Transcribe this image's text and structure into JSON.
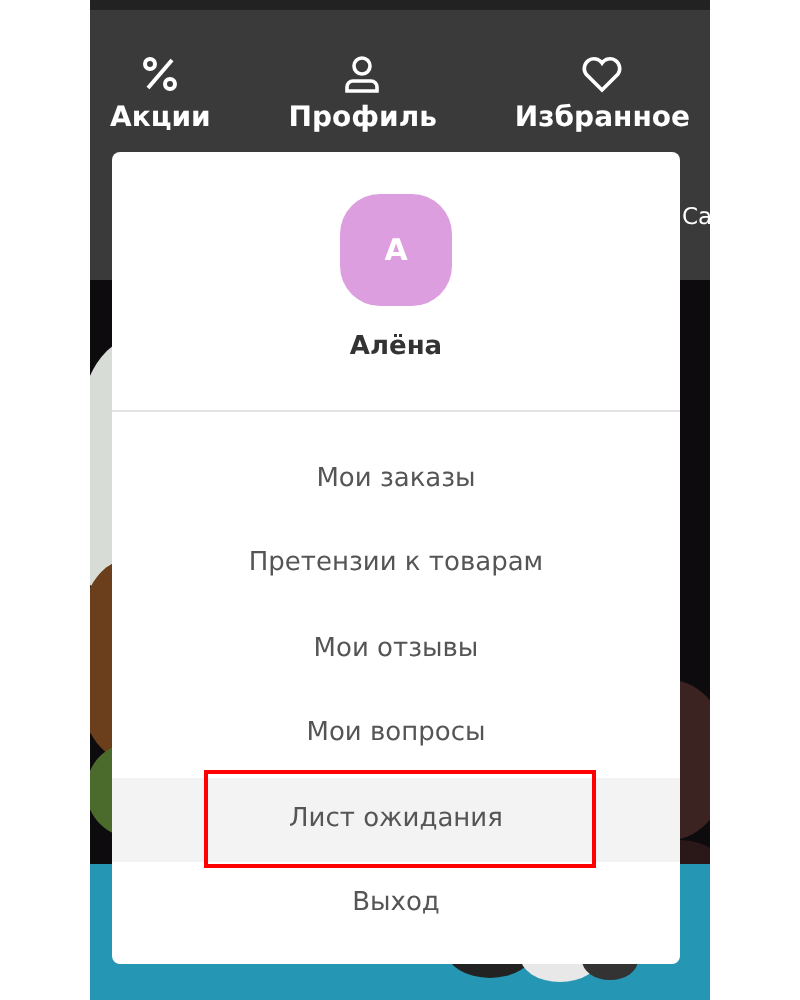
{
  "nav": [
    {
      "label": "Акции"
    },
    {
      "label": "Профиль"
    },
    {
      "label": "Избранное"
    }
  ],
  "category_peek": "Са",
  "profile_menu": {
    "avatar_letter": "А",
    "user_name": "Алёна",
    "items": [
      {
        "label": "Мои заказы",
        "highlighted": false
      },
      {
        "label": "Претензии к товарам",
        "highlighted": false
      },
      {
        "label": "Мои отзывы",
        "highlighted": false
      },
      {
        "label": "Мои вопросы",
        "highlighted": false
      },
      {
        "label": "Лист ожидания",
        "highlighted": true
      },
      {
        "label": "Выход",
        "highlighted": false
      }
    ]
  }
}
